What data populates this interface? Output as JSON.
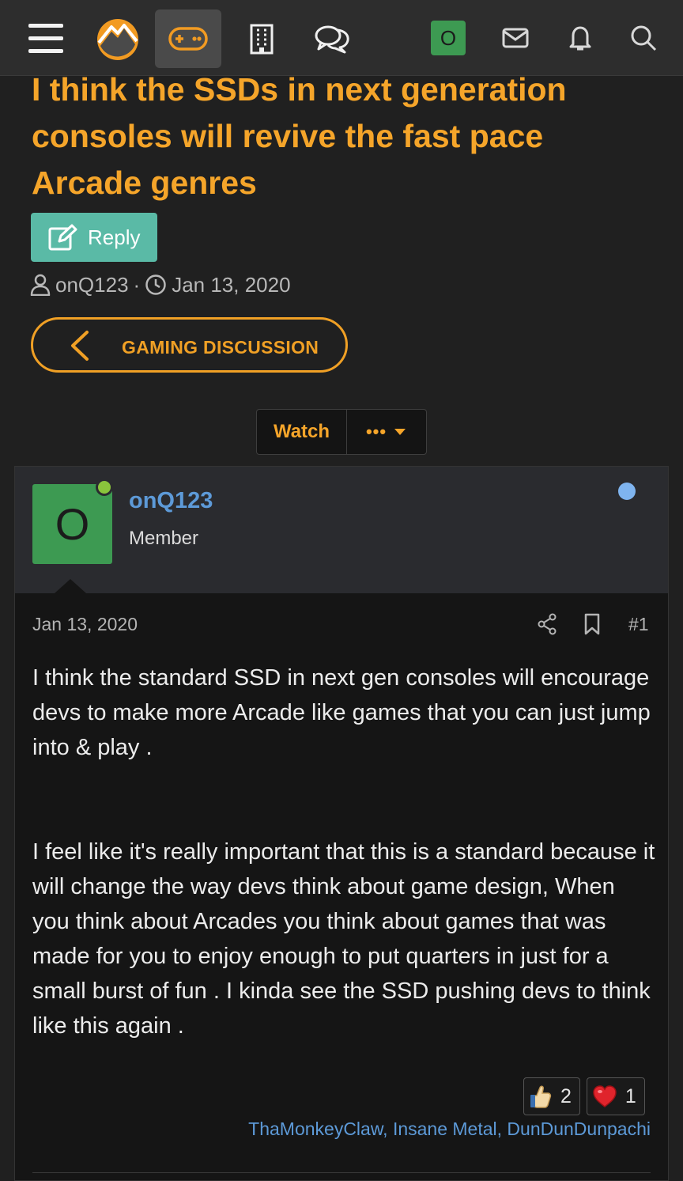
{
  "nav": {
    "badge_text": "O",
    "icons": [
      "menu-icon",
      "site-logo",
      "gamepad-icon",
      "building-icon",
      "chat-bubbles-icon",
      "mail-icon",
      "bell-icon",
      "search-icon"
    ]
  },
  "thread": {
    "title": "I think the SSDs in next generation consoles will revive the fast pace Arcade genres",
    "reply_label": "Reply",
    "author": "onQ123",
    "separator": "·",
    "date": "Jan 13, 2020",
    "forum_label": "GAMING DISCUSSION",
    "watch_label": "Watch",
    "more_label": "•••"
  },
  "post": {
    "avatar_letter": "O",
    "username": "onQ123",
    "user_title": "Member",
    "date": "Jan 13, 2020",
    "number": "#1",
    "paragraphs": [
      "I think the standard SSD in next gen consoles will encourage devs to make more Arcade like games that you can just jump into & play .",
      "I feel like it's really important that this is a standard because it will change the way devs think about game design, When you think about Arcades you think about games that was made for you to enjoy enough to put quarters in just for a small burst of fun . I kinda see the SSD pushing devs to think like this again ."
    ],
    "reactions": [
      {
        "icon": "thumbs-up-icon",
        "count": "2"
      },
      {
        "icon": "heart-icon",
        "count": "1"
      }
    ],
    "reaction_users": "ThaMonkeyClaw, Insane Metal, DunDunDunpachi"
  },
  "colors": {
    "accent": "#f5a52a",
    "link": "#5d9ad8",
    "reply_button": "#5abaa6",
    "avatar": "#3d9a52"
  }
}
